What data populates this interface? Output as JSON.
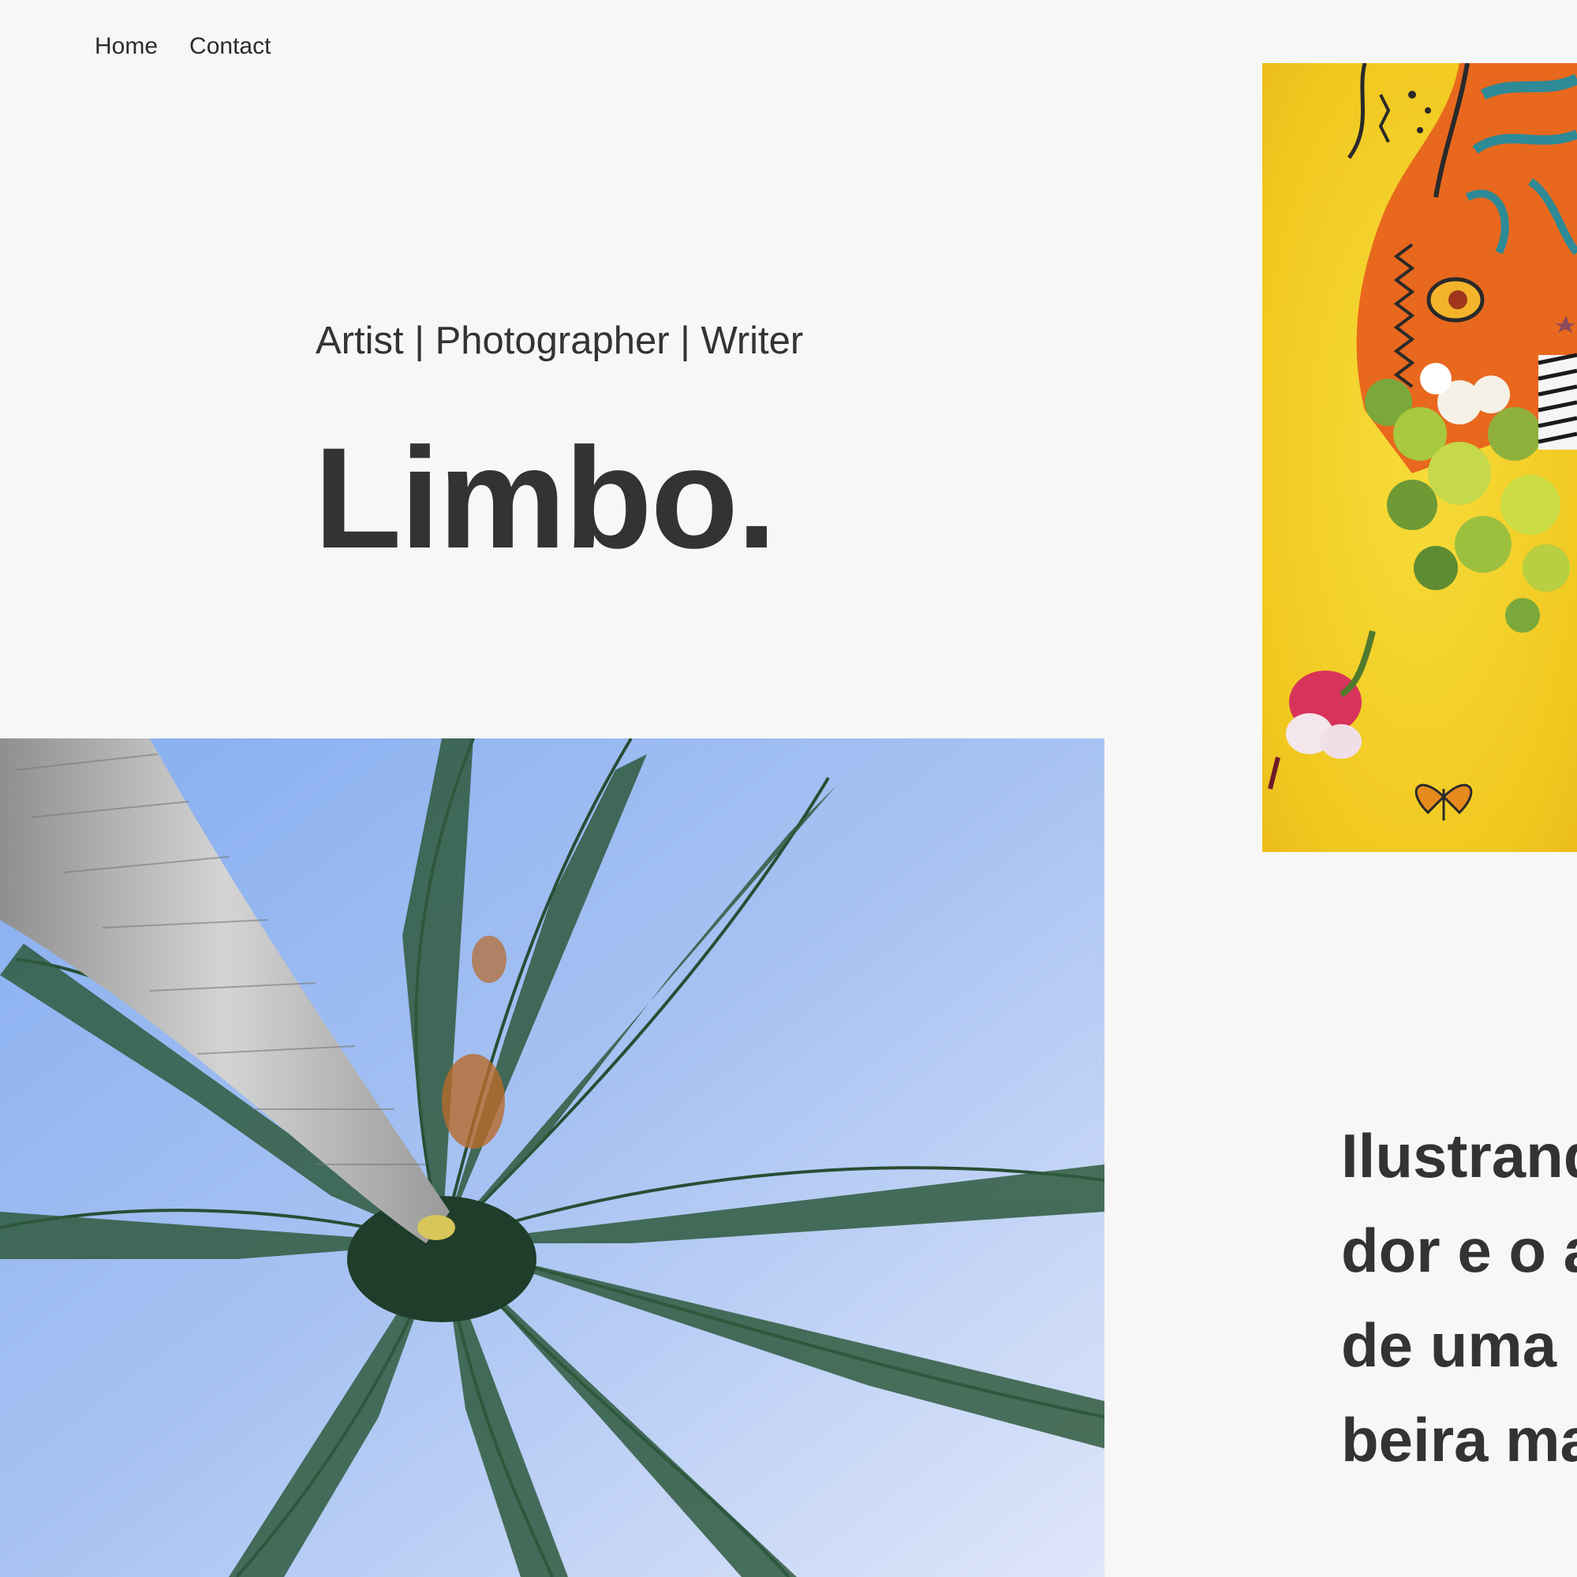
{
  "nav": {
    "items": [
      {
        "label": "Home"
      },
      {
        "label": "Contact"
      }
    ]
  },
  "hero": {
    "subtitle": "Artist | Photographer | Writer",
    "title": "Limbo."
  },
  "quote": {
    "lines": [
      "Ilustrand",
      "dor e o a",
      "de uma",
      "beira ma"
    ]
  },
  "colors": {
    "background": "#f7f7f7",
    "text": "#333333",
    "illustration_bg": "#f2cf2a",
    "sky": "#9dbcf0",
    "palm_green": "#2f5a3e"
  }
}
